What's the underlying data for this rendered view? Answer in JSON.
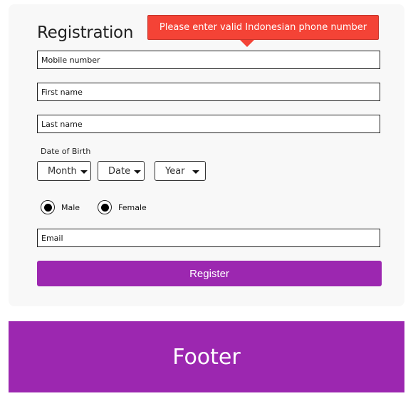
{
  "form": {
    "title": "Registration",
    "error_tooltip": "Please enter valid Indonesian phone number",
    "mobile_placeholder": "Mobile number",
    "first_name_placeholder": "First name",
    "last_name_placeholder": "Last name",
    "dob_label": "Date of Birth",
    "dob_selects": [
      {
        "label": "Month"
      },
      {
        "label": "Date"
      },
      {
        "label": "Year"
      }
    ],
    "gender": [
      {
        "label": "Male",
        "selected": true
      },
      {
        "label": "Female",
        "selected": true
      }
    ],
    "email_placeholder": "Email",
    "register_label": "Register"
  },
  "footer": {
    "text": "Footer"
  },
  "colors": {
    "accent": "#9c27b0",
    "error": "#f44336",
    "card_bg": "#f8f8f8"
  }
}
